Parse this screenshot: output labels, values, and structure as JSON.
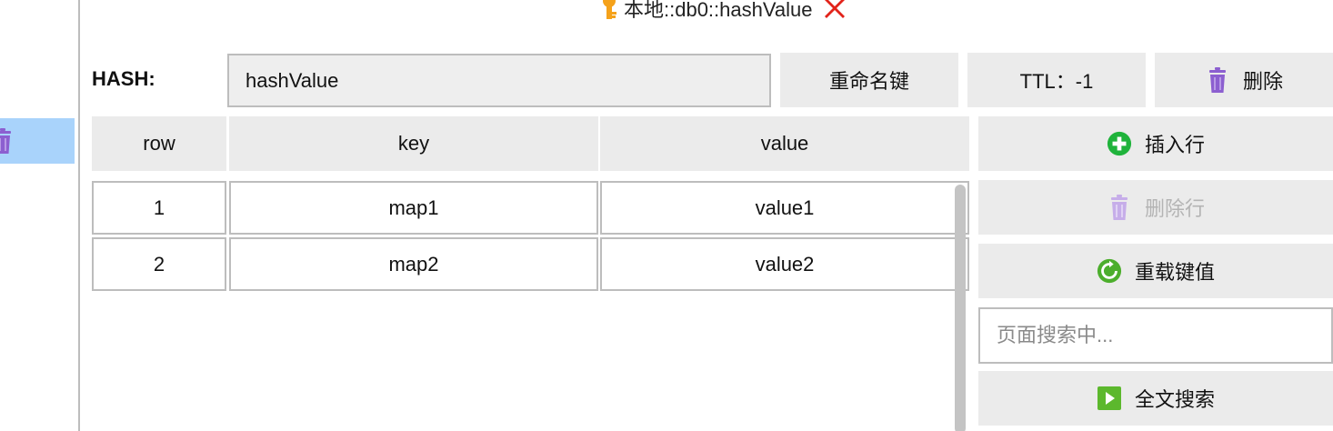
{
  "title": {
    "text": "本地::db0::hashValue",
    "key_icon": "key-icon",
    "close_icon": "close-icon"
  },
  "header": {
    "type_label": "HASH:",
    "key_name": "hashValue",
    "rename_label": "重命名键",
    "ttl_label": "TTL：-1",
    "delete_label": "删除"
  },
  "table": {
    "columns": [
      "row",
      "key",
      "value"
    ],
    "rows": [
      {
        "row": "1",
        "key": "map1",
        "value": "value1"
      },
      {
        "row": "2",
        "key": "map2",
        "value": "value2"
      }
    ]
  },
  "actions": {
    "insert_label": "插入行",
    "delete_row_label": "删除行",
    "reload_label": "重载键值",
    "search_placeholder": "页面搜索中...",
    "fulltext_label": "全文搜索"
  },
  "colors": {
    "accent_green": "#1fb33b",
    "trash_purple": "#8c5fd0",
    "selected_blue": "#a9d3fb",
    "close_red": "#e2231a",
    "key_orange": "#f5a21b"
  }
}
